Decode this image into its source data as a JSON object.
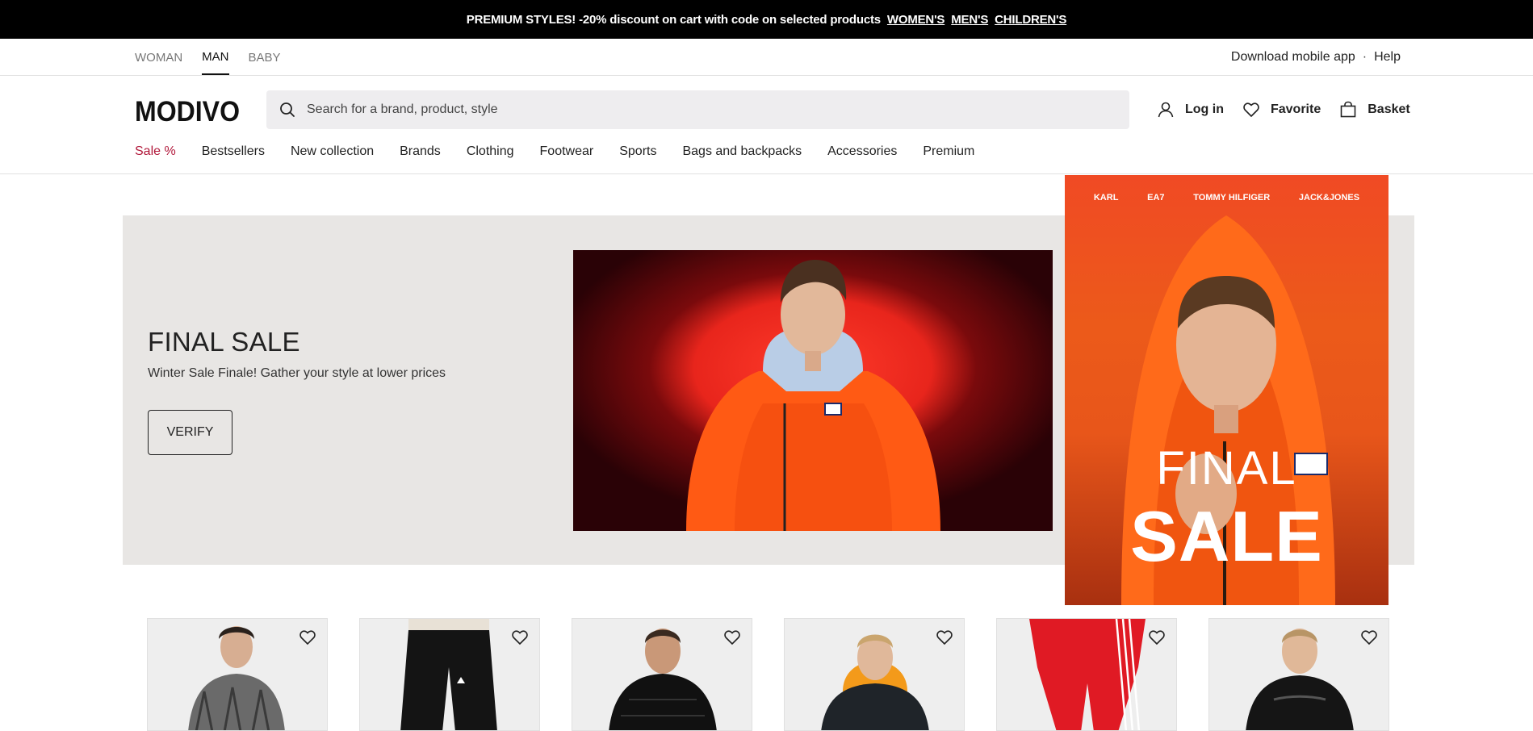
{
  "promo": {
    "text": "PREMIUM STYLES! -20% discount on cart with code on selected products",
    "links": [
      "WOMEN'S",
      "MEN'S",
      "CHILDREN'S"
    ]
  },
  "gender_tabs": [
    {
      "label": "WOMAN",
      "active": false
    },
    {
      "label": "MAN",
      "active": true
    },
    {
      "label": "BABY",
      "active": false
    }
  ],
  "top_links": {
    "download": "Download mobile app",
    "separator": "·",
    "help": "Help"
  },
  "header": {
    "logo_text": "MODIVO",
    "search_placeholder": "Search for a brand, product, style",
    "login": "Log in",
    "favorite": "Favorite",
    "basket": "Basket"
  },
  "categories": [
    "Sale %",
    "Bestsellers",
    "New collection",
    "Brands",
    "Clothing",
    "Footwear",
    "Sports",
    "Bags and backpacks",
    "Accessories",
    "Premium"
  ],
  "hero": {
    "title": "FINAL SALE",
    "subtitle": "Winter Sale Finale! Gather your style at lower prices",
    "button": "VERIFY"
  },
  "ad": {
    "brands": [
      "KARL",
      "EA7",
      "TOMMY HILFIGER",
      "JACK&JONES"
    ],
    "line1": "FINAL",
    "line2": "SALE"
  },
  "products": [
    {
      "icon": "sweater-image"
    },
    {
      "icon": "pants-image"
    },
    {
      "icon": "jacket-image"
    },
    {
      "icon": "jacket-image"
    },
    {
      "icon": "tracksuit-image"
    },
    {
      "icon": "jacket-image"
    }
  ],
  "colors": {
    "promo_bg": "#000000",
    "sale_accent": "#b1183a",
    "hero_bg": "#e8e6e4",
    "ad_orange": "#ec5a1a"
  }
}
